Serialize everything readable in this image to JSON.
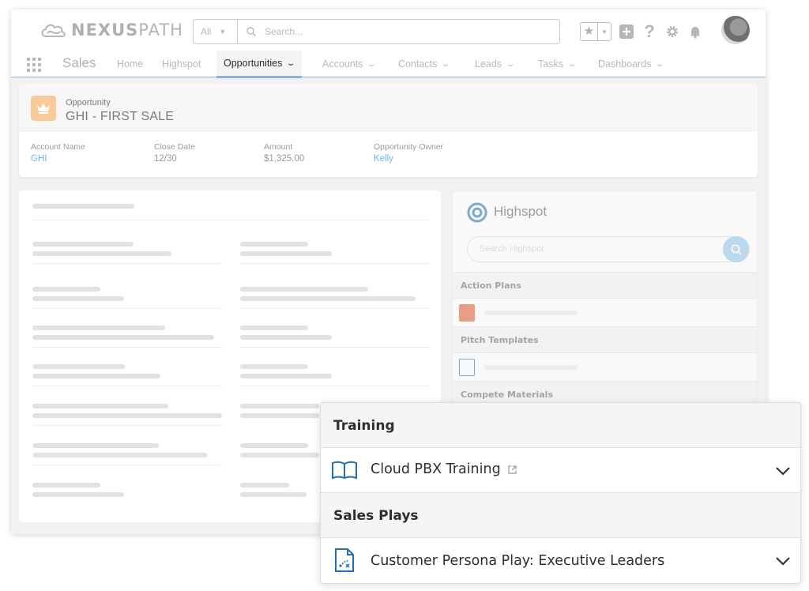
{
  "brand": {
    "name_bold": "NEXUS",
    "name_light": "PATH"
  },
  "search": {
    "scope": "All",
    "placeholder": "Search..."
  },
  "nav": {
    "app_name": "Sales",
    "tabs": [
      {
        "label": "Home"
      },
      {
        "label": "Highspot"
      },
      {
        "label": "Opportunities"
      },
      {
        "label": "Accounts"
      },
      {
        "label": "Contacts"
      },
      {
        "label": "Leads"
      },
      {
        "label": "Tasks"
      },
      {
        "label": "Dashboards"
      }
    ]
  },
  "record": {
    "kind": "Opportunity",
    "title": "GHI - FIRST SALE",
    "fields": [
      {
        "key": "Account Name",
        "value": "GHI"
      },
      {
        "key": "Close Date",
        "value": "12/30"
      },
      {
        "key": "Amount",
        "value": "$1,325.00"
      },
      {
        "key": "Opportunity Owner",
        "value": "Kelly"
      }
    ]
  },
  "highspot_panel": {
    "title": "Highspot",
    "search_placeholder": "Search Highspot",
    "sections": [
      "Action Plans",
      "Pitch Templates",
      "Compete Materials"
    ]
  },
  "popup": {
    "sections": [
      {
        "label": "Training",
        "item": "Cloud PBX Training"
      },
      {
        "label": "Sales Plays",
        "item": "Customer Persona Play: Executive Leaders"
      }
    ]
  },
  "colors": {
    "accent_blue": "#1f6fb5",
    "link_blue": "#6fb4f0",
    "opportunity_icon": "#f9c89b",
    "nav_underline": "#8fb2d6"
  }
}
